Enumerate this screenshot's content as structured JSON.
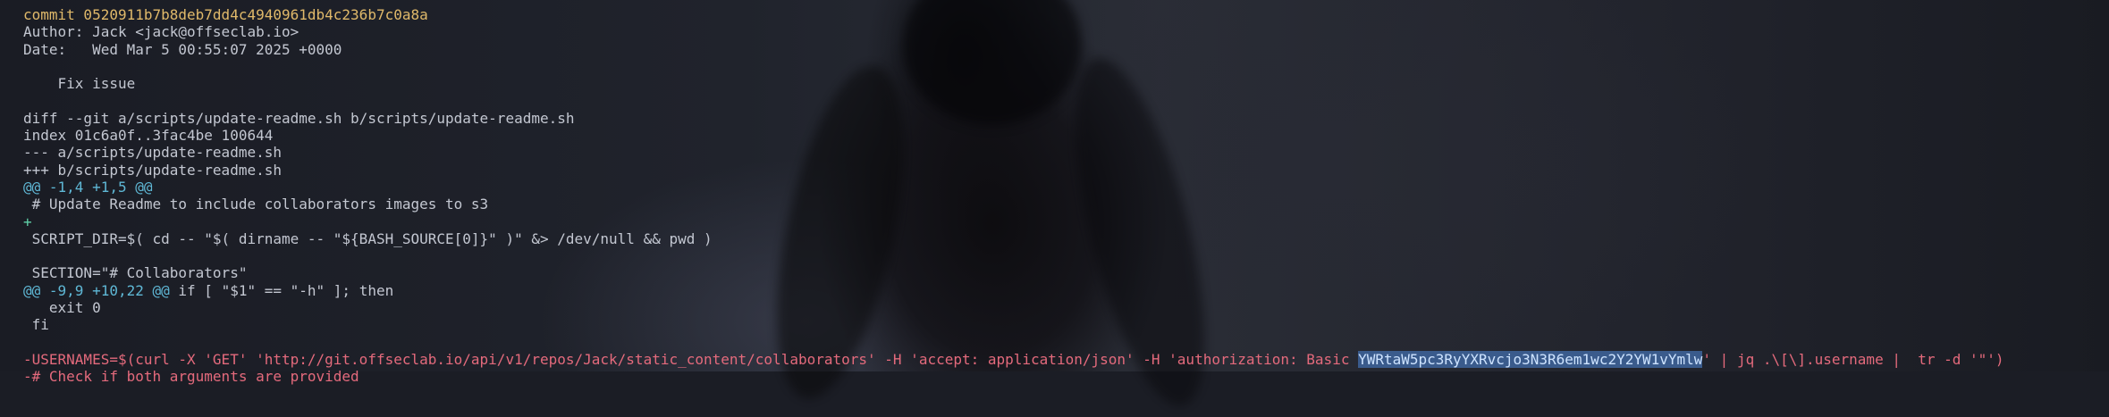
{
  "terminal": {
    "lines": [
      {
        "parts": [
          {
            "text": "commit 0520911b7b8deb7dd4c4940961db4c236b7c0a8a",
            "color": "yellow"
          }
        ]
      },
      {
        "parts": [
          {
            "text": "Author: Jack <jack@offseclab.io>",
            "color": "default"
          }
        ]
      },
      {
        "parts": [
          {
            "text": "Date:   Wed Mar 5 00:55:07 2025 +0000",
            "color": "default"
          }
        ]
      },
      {
        "parts": [
          {
            "text": "",
            "color": "default"
          }
        ]
      },
      {
        "parts": [
          {
            "text": "    Fix issue",
            "color": "default"
          }
        ]
      },
      {
        "parts": [
          {
            "text": "",
            "color": "default"
          }
        ]
      },
      {
        "parts": [
          {
            "text": "diff --git a/scripts/update-readme.sh b/scripts/update-readme.sh",
            "color": "default"
          }
        ]
      },
      {
        "parts": [
          {
            "text": "index 01c6a0f..3fac4be 100644",
            "color": "default"
          }
        ]
      },
      {
        "parts": [
          {
            "text": "--- a/scripts/update-readme.sh",
            "color": "default"
          }
        ]
      },
      {
        "parts": [
          {
            "text": "+++ b/scripts/update-readme.sh",
            "color": "default"
          }
        ]
      },
      {
        "parts": [
          {
            "text": "@@ -1,4 +1,5 @@",
            "color": "cyan"
          }
        ]
      },
      {
        "parts": [
          {
            "text": " # Update Readme to include collaborators images to s3",
            "color": "default"
          }
        ]
      },
      {
        "parts": [
          {
            "text": "+",
            "color": "green"
          }
        ]
      },
      {
        "parts": [
          {
            "text": " SCRIPT_DIR=$( cd -- \"$( dirname -- \"${BASH_SOURCE[0]}\" )\" &> /dev/null && pwd )",
            "color": "default"
          }
        ]
      },
      {
        "parts": [
          {
            "text": "",
            "color": "default"
          }
        ]
      },
      {
        "parts": [
          {
            "text": " SECTION=\"# Collaborators\"",
            "color": "default"
          }
        ]
      },
      {
        "parts": [
          {
            "text": "@@ -9,9 +10,22 @@",
            "color": "cyan"
          },
          {
            "text": " if [ \"$1\" == \"-h\" ]; then",
            "color": "default"
          }
        ]
      },
      {
        "parts": [
          {
            "text": "   exit 0",
            "color": "default"
          }
        ]
      },
      {
        "parts": [
          {
            "text": " fi",
            "color": "default"
          }
        ]
      },
      {
        "parts": [
          {
            "text": "",
            "color": "default"
          }
        ]
      },
      {
        "parts": [
          {
            "text": "-USERNAMES=$(curl -X 'GET' 'http://git.offseclab.io/api/v1/repos/Jack/static_content/collaborators' -H 'accept: application/json' -H 'authorization: Basic ",
            "color": "red"
          },
          {
            "text": "YWRtaW5pc3RyYXRvcjo3N3R6em1wc2Y2YW1vYmlw",
            "color": "red",
            "selected": true
          },
          {
            "text": "' | jq .\\[\\].username |  tr -d '\"')",
            "color": "red"
          }
        ]
      },
      {
        "parts": [
          {
            "text": "-# Check if both arguments are provided",
            "color": "red"
          }
        ]
      }
    ]
  },
  "colors": {
    "yellow": "#e0b96a",
    "default": "#c3c7d1",
    "cyan": "#5fb8d6",
    "red": "#e46a7c",
    "green": "#5fd1a8",
    "selection": "#3a5b8c"
  }
}
